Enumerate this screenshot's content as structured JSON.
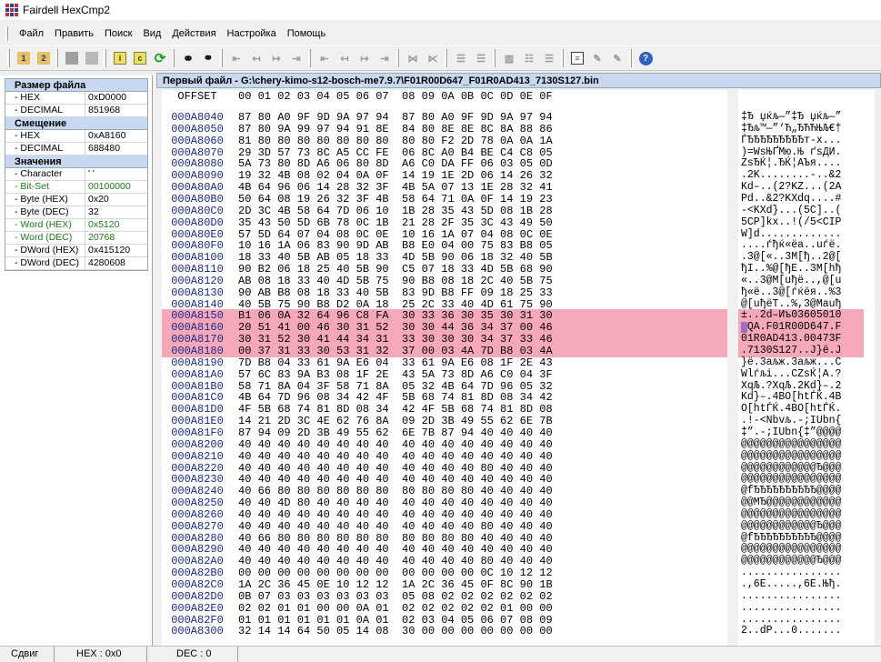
{
  "app": {
    "title": "Fairdell HexCmp2"
  },
  "menu": [
    "Файл",
    "Править",
    "Поиск",
    "Вид",
    "Действия",
    "Настройка",
    "Помощь"
  ],
  "left": {
    "file_size": {
      "title": "Размер файла",
      "rows": [
        {
          "name": "- HEX",
          "value": "0xD0000"
        },
        {
          "name": "- DECIMAL",
          "value": "851968"
        }
      ]
    },
    "offset": {
      "title": "Смещение",
      "rows": [
        {
          "name": "- HEX",
          "value": "0xA8160"
        },
        {
          "name": "- DECIMAL",
          "value": "688480"
        }
      ]
    },
    "values": {
      "title": "Значения",
      "rows": [
        {
          "name": "- Character",
          "value": "' '",
          "green": false
        },
        {
          "name": "- Bit-Set",
          "value": "00100000",
          "green": true
        },
        {
          "name": "- Byte (HEX)",
          "value": "0x20",
          "green": false
        },
        {
          "name": "- Byte (DEC)",
          "value": "32",
          "green": false
        },
        {
          "name": "- Word (HEX)",
          "value": "0x5120",
          "green": true
        },
        {
          "name": "- Word (DEC)",
          "value": "20768",
          "green": true
        },
        {
          "name": "- DWord (HEX)",
          "value": "0x415120",
          "green": false
        },
        {
          "name": "- DWord (DEC)",
          "value": "4280608",
          "green": false
        }
      ]
    }
  },
  "file_header": "Первый файл - G:\\chery-kimo-s12-bosch-me7.9.7\\F01R00D647_F01R0AD413_7130S127.bin",
  "hex_header": {
    "offset": "OFFSET",
    "cols": "00 01 02 03 04 05 06 07  08 09 0A 0B 0C 0D 0E 0F"
  },
  "rows": [
    {
      "off": "000A8040",
      "hex": "87 80 A0 9F 9D 9A 97 94  87 80 A0 9F 9D 9A 97 94",
      "asc": "‡Ђ џќљ—”‡Ђ џќљ—”"
    },
    {
      "off": "000A8050",
      "hex": "87 80 9A 99 97 94 91 8E  84 80 8E 8E 8C 8A 88 86",
      "asc": "‡Ђљ™—”‘Ћ„ЂЋЋЊЉ€†"
    },
    {
      "off": "000A8060",
      "hex": "81 80 80 80 80 80 80 80  80 80 F2 2D 78 0A 0A 1A",
      "asc": "ЃЂЂЂЂЂЂЂЂЂт-x..."
    },
    {
      "off": "000A8070",
      "hex": "29 3D 57 73 8C A5 CC FE  06 8C A0 B4 BE C4 C8 05",
      "asc": ")=WsЊҐМю.Њ ґѕДИ."
    },
    {
      "off": "000A8080",
      "hex": "5A 73 80 8D A6 06 80 8D  A6 C0 DA FF 06 03 05 0D",
      "asc": "ZsЂЌ¦.ЂЌ¦АЪя...."
    },
    {
      "off": "000A8090",
      "hex": "19 32 4B 08 02 04 0A 0F  14 19 1E 2D 06 14 26 32",
      "asc": ".2K........-..&2"
    },
    {
      "off": "000A80A0",
      "hex": "4B 64 96 06 14 28 32 3F  4B 5A 07 13 1E 28 32 41",
      "asc": "Kd–..(2?KZ...(2A"
    },
    {
      "off": "000A80B0",
      "hex": "50 64 08 19 26 32 3F 4B  58 64 71 0A 0F 14 19 23",
      "asc": "Pd..&2?KXdq....#"
    },
    {
      "off": "000A80C0",
      "hex": "2D 3C 4B 58 64 7D 06 10  1B 28 35 43 5D 08 1B 28",
      "asc": "-<KXd}...(5C]..("
    },
    {
      "off": "000A80D0",
      "hex": "35 43 50 5D 6B 78 0C 1B  21 28 2F 35 3C 43 49 50",
      "asc": "5CP]kx..!(/5<CIP"
    },
    {
      "off": "000A80E0",
      "hex": "57 5D 64 07 04 08 0C 0E  10 16 1A 07 04 08 0C 0E",
      "asc": "W]d............."
    },
    {
      "off": "000A80F0",
      "hex": "10 16 1A 06 83 90 9D AB  B8 E0 04 00 75 83 B8 05",
      "asc": "....ѓђќ«ёа..uѓё."
    },
    {
      "off": "000A8100",
      "hex": "18 33 40 5B AB 05 18 33  4D 5B 90 06 18 32 40 5B",
      "asc": ".3@[«..3M[ђ..2@["
    },
    {
      "off": "000A8110",
      "hex": "90 B2 06 18 25 40 5B 90  C5 07 18 33 4D 5B 68 90",
      "asc": "ђІ..%@[ђЕ..3M[hђ"
    },
    {
      "off": "000A8120",
      "hex": "AB 08 18 33 40 4D 5B 75  90 B8 08 18 2C 40 5B 75",
      "asc": "«..3@M[uђё..,@[u"
    },
    {
      "off": "000A8130",
      "hex": "90 AB B8 08 18 33 40 5B  83 9D B8 FF 09 18 25 33",
      "asc": "ђ«ё..3@[ѓќёя..%3"
    },
    {
      "off": "000A8140",
      "hex": "40 5B 75 90 B8 D2 0A 18  25 2C 33 40 4D 61 75 90",
      "asc": "@[uђёТ..%,3@Mauђ"
    },
    {
      "off": "000A8150",
      "hex": "B1 06 0A 32 64 96 C8 FA  30 33 36 30 35 30 31 30",
      "asc": "±..2d–Иъ03605010",
      "hl": true
    },
    {
      "off": "000A8160",
      "hex": "20 51 41 00 46 30 31 52  30 30 44 36 34 37 00 46",
      "asc": " QA.F01R00D647.F",
      "hl": true
    },
    {
      "off": "000A8170",
      "hex": "30 31 52 30 41 44 34 31  33 30 30 30 34 37 33 46",
      "asc": "01R0AD413.00473F",
      "hl": true
    },
    {
      "off": "000A8180",
      "hex": "00 37 31 33 30 53 31 32  37 00 03 4A 7D B8 03 4A",
      "asc": ".7130S127..J}ё.J",
      "hl": true
    },
    {
      "off": "000A8190",
      "hex": "7D B8 04 33 61 9A E6 04  33 61 9A E6 08 1F 2E 43",
      "asc": "}ё.3aљж.3aљж...C"
    },
    {
      "off": "000A81A0",
      "hex": "57 6C 83 9A B3 08 1F 2E  43 5A 73 8D A6 C0 04 3F",
      "asc": "Wlѓљі...CZsЌ¦А.?"
    },
    {
      "off": "000A81B0",
      "hex": "58 71 8A 04 3F 58 71 8A  05 32 4B 64 7D 96 05 32",
      "asc": "XqЉ.?XqЉ.2Kd}–.2"
    },
    {
      "off": "000A81C0",
      "hex": "4B 64 7D 96 08 34 42 4F  5B 68 74 81 8D 08 34 42",
      "asc": "Kd}–.4BO[htЃЌ.4B"
    },
    {
      "off": "000A81D0",
      "hex": "4F 5B 68 74 81 8D 08 34  42 4F 5B 68 74 81 8D 08",
      "asc": "O[htЃЌ.4BO[htЃЌ."
    },
    {
      "off": "000A81E0",
      "hex": "14 21 2D 3C 4E 62 76 8A  09 2D 3B 49 55 62 6E 7B",
      "asc": ".!-<Nbvљ.-;IUbn{"
    },
    {
      "off": "000A81F0",
      "hex": "87 94 09 2D 3B 49 55 62  6E 7B 87 94 40 40 40 40",
      "asc": "‡”.-;IUbn{‡”@@@@"
    },
    {
      "off": "000A8200",
      "hex": "40 40 40 40 40 40 40 40  40 40 40 40 40 40 40 40",
      "asc": "@@@@@@@@@@@@@@@@"
    },
    {
      "off": "000A8210",
      "hex": "40 40 40 40 40 40 40 40  40 40 40 40 40 40 40 40",
      "asc": "@@@@@@@@@@@@@@@@"
    },
    {
      "off": "000A8220",
      "hex": "40 40 40 40 40 40 40 40  40 40 40 40 80 40 40 40",
      "asc": "@@@@@@@@@@@@Ђ@@@"
    },
    {
      "off": "000A8230",
      "hex": "40 40 40 40 40 40 40 40  40 40 40 40 40 40 40 40",
      "asc": "@@@@@@@@@@@@@@@@"
    },
    {
      "off": "000A8240",
      "hex": "40 66 80 80 80 80 80 80  80 80 80 80 40 40 40 40",
      "asc": "@fЂЂЂЂЂЂЂЂЂЂ@@@@"
    },
    {
      "off": "000A8250",
      "hex": "40 40 4D 80 40 40 40 40  40 40 40 40 40 40 40 40",
      "asc": "@@MЂ@@@@@@@@@@@@"
    },
    {
      "off": "000A8260",
      "hex": "40 40 40 40 40 40 40 40  40 40 40 40 40 40 40 40",
      "asc": "@@@@@@@@@@@@@@@@"
    },
    {
      "off": "000A8270",
      "hex": "40 40 40 40 40 40 40 40  40 40 40 40 80 40 40 40",
      "asc": "@@@@@@@@@@@@Ђ@@@"
    },
    {
      "off": "000A8280",
      "hex": "40 66 80 80 80 80 80 80  80 80 80 80 40 40 40 40",
      "asc": "@fЂЂЂЂЂЂЂЂЂЂ@@@@"
    },
    {
      "off": "000A8290",
      "hex": "40 40 40 40 40 40 40 40  40 40 40 40 40 40 40 40",
      "asc": "@@@@@@@@@@@@@@@@"
    },
    {
      "off": "000A82A0",
      "hex": "40 40 40 40 40 40 40 40  40 40 40 40 80 40 40 40",
      "asc": "@@@@@@@@@@@@Ђ@@@"
    },
    {
      "off": "000A82B0",
      "hex": "00 00 00 00 00 00 00 00  00 00 00 00 0C 10 12 12",
      "asc": "................"
    },
    {
      "off": "000A82C0",
      "hex": "1A 2C 36 45 0E 10 12 12  1A 2C 36 45 0F 8C 90 1B",
      "asc": ".,6E.....,6E.Њђ."
    },
    {
      "off": "000A82D0",
      "hex": "0B 07 03 03 03 03 03 03  05 08 02 02 02 02 02 02",
      "asc": "................"
    },
    {
      "off": "000A82E0",
      "hex": "02 02 01 01 00 00 0A 01  02 02 02 02 02 01 00 00",
      "asc": "................"
    },
    {
      "off": "000A82F0",
      "hex": "01 01 01 01 01 01 0A 01  02 03 04 05 06 07 08 09",
      "asc": "................"
    },
    {
      "off": "000A8300",
      "hex": "32 14 14 64 50 05 14 08  30 00 00 00 00 00 00 00",
      "asc": "2..dP...0......."
    }
  ],
  "status": {
    "left": "Сдвиг",
    "hex": "HEX : 0x0",
    "dec": "DEC : 0"
  },
  "colors": {
    "highlight": "#f4a8b8",
    "offset_text": "#1a2a90",
    "value_green": "#1a7a1a",
    "section_bg": "#c8d8f0"
  },
  "icons": [
    "app-icon",
    "open-file-1-icon",
    "open-file-2-icon",
    "stop-icon",
    "save-icon",
    "info-icon",
    "compare-icon",
    "refresh-icon",
    "binoculars-icon",
    "find-next-icon",
    "first-diff-icon",
    "prev-diff-icon",
    "next-diff-icon",
    "last-diff-icon",
    "first-block-icon",
    "prev-block-icon",
    "next-block-icon",
    "last-block-icon",
    "sync-icon",
    "unsync-icon",
    "layout-1-icon",
    "layout-2-icon",
    "layout-3-icon",
    "layout-4-icon",
    "report-icon",
    "edit-1-icon",
    "edit-2-icon",
    "help-icon"
  ]
}
